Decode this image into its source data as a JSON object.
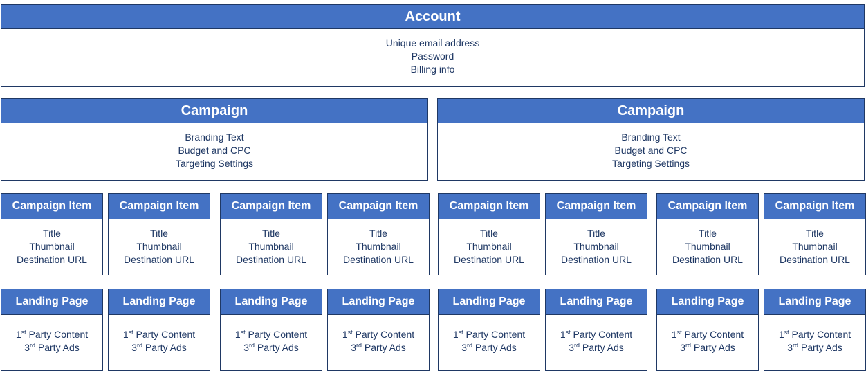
{
  "account": {
    "title": "Account",
    "lines": [
      "Unique email address",
      "Password",
      "Billing info"
    ]
  },
  "campaigns": [
    {
      "title": "Campaign",
      "lines": [
        "Branding Text",
        "Budget and CPC",
        "Targeting Settings"
      ]
    },
    {
      "title": "Campaign",
      "lines": [
        "Branding Text",
        "Budget and CPC",
        "Targeting Settings"
      ]
    }
  ],
  "campaign_items": [
    {
      "title": "Campaign Item",
      "lines": [
        "Title",
        "Thumbnail",
        "Destination URL"
      ]
    },
    {
      "title": "Campaign Item",
      "lines": [
        "Title",
        "Thumbnail",
        "Destination URL"
      ]
    },
    {
      "title": "Campaign Item",
      "lines": [
        "Title",
        "Thumbnail",
        "Destination URL"
      ]
    },
    {
      "title": "Campaign Item",
      "lines": [
        "Title",
        "Thumbnail",
        "Destination URL"
      ]
    },
    {
      "title": "Campaign Item",
      "lines": [
        "Title",
        "Thumbnail",
        "Destination URL"
      ]
    },
    {
      "title": "Campaign Item",
      "lines": [
        "Title",
        "Thumbnail",
        "Destination URL"
      ]
    },
    {
      "title": "Campaign Item",
      "lines": [
        "Title",
        "Thumbnail",
        "Destination URL"
      ]
    },
    {
      "title": "Campaign Item",
      "lines": [
        "Title",
        "Thumbnail",
        "Destination URL"
      ]
    }
  ],
  "landing_pages": [
    {
      "title": "Landing Page",
      "lines": [
        {
          "n": "1",
          "sup": "st",
          "t": " Party Content"
        },
        {
          "n": "3",
          "sup": "rd",
          "t": " Party Ads"
        }
      ]
    },
    {
      "title": "Landing Page",
      "lines": [
        {
          "n": "1",
          "sup": "st",
          "t": " Party Content"
        },
        {
          "n": "3",
          "sup": "rd",
          "t": " Party Ads"
        }
      ]
    },
    {
      "title": "Landing Page",
      "lines": [
        {
          "n": "1",
          "sup": "st",
          "t": " Party Content"
        },
        {
          "n": "3",
          "sup": "rd",
          "t": " Party Ads"
        }
      ]
    },
    {
      "title": "Landing Page",
      "lines": [
        {
          "n": "1",
          "sup": "st",
          "t": " Party Content"
        },
        {
          "n": "3",
          "sup": "rd",
          "t": " Party Ads"
        }
      ]
    },
    {
      "title": "Landing Page",
      "lines": [
        {
          "n": "1",
          "sup": "st",
          "t": " Party Content"
        },
        {
          "n": "3",
          "sup": "rd",
          "t": " Party Ads"
        }
      ]
    },
    {
      "title": "Landing Page",
      "lines": [
        {
          "n": "1",
          "sup": "st",
          "t": " Party Content"
        },
        {
          "n": "3",
          "sup": "rd",
          "t": " Party Ads"
        }
      ]
    },
    {
      "title": "Landing Page",
      "lines": [
        {
          "n": "1",
          "sup": "st",
          "t": " Party Content"
        },
        {
          "n": "3",
          "sup": "rd",
          "t": " Party Ads"
        }
      ]
    },
    {
      "title": "Landing Page",
      "lines": [
        {
          "n": "1",
          "sup": "st",
          "t": " Party Content"
        },
        {
          "n": "3",
          "sup": "rd",
          "t": " Party Ads"
        }
      ]
    }
  ],
  "colors": {
    "header_fill": "#4472c4",
    "border": "#1f3864",
    "body_text": "#1f3864",
    "header_text": "#ffffff"
  }
}
